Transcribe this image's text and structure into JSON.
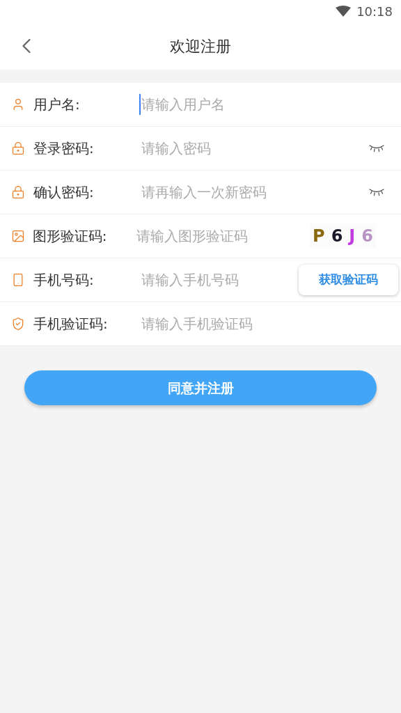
{
  "status_bar": {
    "time": "10:18"
  },
  "header": {
    "title": "欢迎注册"
  },
  "fields": [
    {
      "kind": "user",
      "label": "用户名:",
      "placeholder": "请输入用户名",
      "focused": true
    },
    {
      "kind": "password",
      "label": "登录密码:",
      "placeholder": "请输入密码",
      "focused": false
    },
    {
      "kind": "password",
      "label": "确认密码:",
      "placeholder": "请再输入一次新密码",
      "focused": false
    },
    {
      "kind": "captcha",
      "label": "图形验证码:",
      "placeholder": "请输入图形验证码",
      "focused": false,
      "captcha": [
        {
          "char": "P",
          "color": "#8a6a10"
        },
        {
          "char": "6",
          "color": "#1a1a2a"
        },
        {
          "char": "J",
          "color": "#c23be0"
        },
        {
          "char": "6",
          "color": "#b894c4"
        }
      ]
    },
    {
      "kind": "phone",
      "label": "手机号码:",
      "placeholder": "请输入手机号码",
      "focused": false,
      "button": "获取验证码"
    },
    {
      "kind": "sms",
      "label": "手机验证码:",
      "placeholder": "请输入手机验证码",
      "focused": false
    }
  ],
  "submit": "同意并注册"
}
